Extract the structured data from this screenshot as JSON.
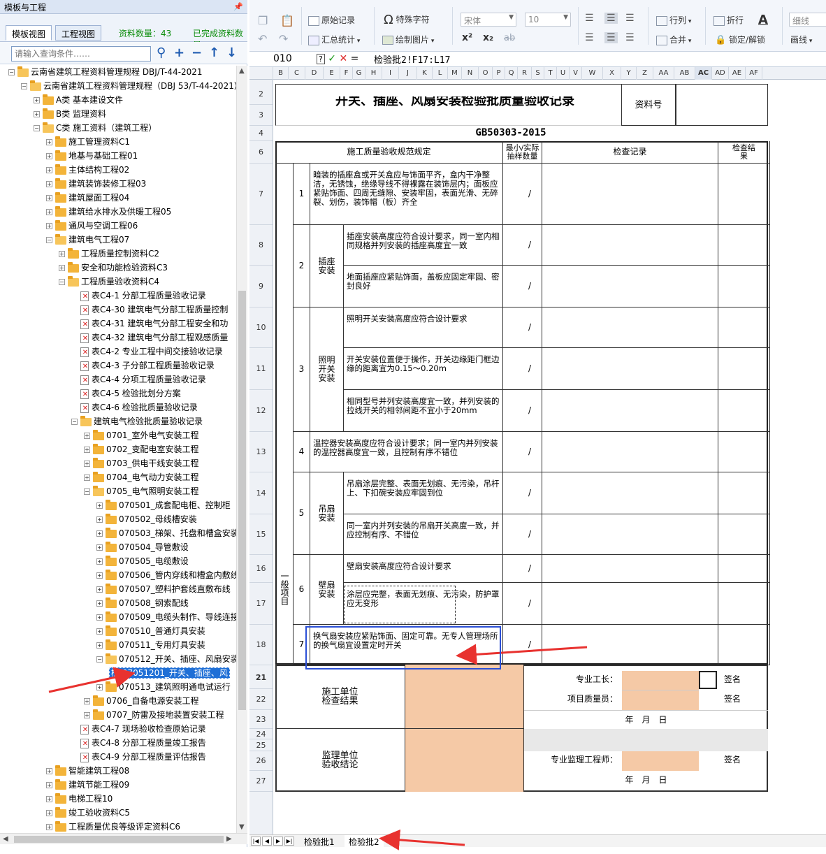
{
  "left_panel": {
    "title": "模板与工程",
    "tabs": [
      "模板视图",
      "工程视图"
    ],
    "count_label": "资料数量：43",
    "complete_label": "已完成资料数量",
    "search_placeholder": "请输入查询条件……",
    "tree": [
      {
        "level": 0,
        "type": "folder",
        "label": "云南省建筑工程资料管理规程 DBJ/T-44-2021",
        "expanded": true
      },
      {
        "level": 1,
        "type": "folder",
        "label": "云南省建筑工程资料管理规程（DBJ 53/T-44-2021）",
        "expanded": true
      },
      {
        "level": 2,
        "type": "folder",
        "label": "A类 基本建设文件",
        "expanded": false
      },
      {
        "level": 2,
        "type": "folder",
        "label": "B类 监理资料",
        "expanded": false
      },
      {
        "level": 2,
        "type": "folder",
        "label": "C类 施工资料（建筑工程）",
        "expanded": true
      },
      {
        "level": 3,
        "type": "folder",
        "label": "施工管理资料C1",
        "expanded": false
      },
      {
        "level": 3,
        "type": "folder",
        "label": "地基与基础工程01",
        "expanded": false
      },
      {
        "level": 3,
        "type": "folder",
        "label": "主体结构工程02",
        "expanded": false
      },
      {
        "level": 3,
        "type": "folder",
        "label": "建筑装饰装修工程03",
        "expanded": false
      },
      {
        "level": 3,
        "type": "folder",
        "label": "建筑屋面工程04",
        "expanded": false
      },
      {
        "level": 3,
        "type": "folder",
        "label": "建筑给水排水及供暖工程05",
        "expanded": false
      },
      {
        "level": 3,
        "type": "folder",
        "label": "通风与空调工程06",
        "expanded": false
      },
      {
        "level": 3,
        "type": "folder",
        "label": "建筑电气工程07",
        "expanded": true
      },
      {
        "level": 4,
        "type": "folder",
        "label": "工程质量控制资料C2",
        "expanded": false
      },
      {
        "level": 4,
        "type": "folder",
        "label": "安全和功能检验资料C3",
        "expanded": false
      },
      {
        "level": 4,
        "type": "folder",
        "label": "工程质量验收资料C4",
        "expanded": true
      },
      {
        "level": 5,
        "type": "doc",
        "label": "表C4-1 分部工程质量验收记录"
      },
      {
        "level": 5,
        "type": "doc",
        "label": "表C4-30 建筑电气分部工程质量控制"
      },
      {
        "level": 5,
        "type": "doc",
        "label": "表C4-31 建筑电气分部工程安全和功"
      },
      {
        "level": 5,
        "type": "doc",
        "label": "表C4-32 建筑电气分部工程观感质量"
      },
      {
        "level": 5,
        "type": "doc",
        "label": "表C4-2 专业工程中间交接验收记录"
      },
      {
        "level": 5,
        "type": "doc",
        "label": "表C4-3 子分部工程质量验收记录"
      },
      {
        "level": 5,
        "type": "doc",
        "label": "表C4-4 分项工程质量验收记录"
      },
      {
        "level": 5,
        "type": "doc",
        "label": "表C4-5 检验批划分方案"
      },
      {
        "level": 5,
        "type": "doc",
        "label": "表C4-6 检验批质量验收记录"
      },
      {
        "level": 5,
        "type": "folder",
        "label": "建筑电气检验批质量验收记录",
        "expanded": true
      },
      {
        "level": 6,
        "type": "folder",
        "label": "0701_室外电气安装工程",
        "expanded": false
      },
      {
        "level": 6,
        "type": "folder",
        "label": "0702_变配电室安装工程",
        "expanded": false
      },
      {
        "level": 6,
        "type": "folder",
        "label": "0703_供电干线安装工程",
        "expanded": false
      },
      {
        "level": 6,
        "type": "folder",
        "label": "0704_电气动力安装工程",
        "expanded": false
      },
      {
        "level": 6,
        "type": "folder",
        "label": "0705_电气照明安装工程",
        "expanded": true
      },
      {
        "level": 7,
        "type": "folder",
        "label": "070501_成套配电柜、控制柜",
        "expanded": false
      },
      {
        "level": 7,
        "type": "folder",
        "label": "070502_母线槽安装",
        "expanded": false
      },
      {
        "level": 7,
        "type": "folder",
        "label": "070503_梯架、托盘和槽盒安装",
        "expanded": false
      },
      {
        "level": 7,
        "type": "folder",
        "label": "070504_导管敷设",
        "expanded": false
      },
      {
        "level": 7,
        "type": "folder",
        "label": "070505_电缆敷设",
        "expanded": false
      },
      {
        "level": 7,
        "type": "folder",
        "label": "070506_管内穿线和槽盒内敷线",
        "expanded": false
      },
      {
        "level": 7,
        "type": "folder",
        "label": "070507_塑料护套线直敷布线",
        "expanded": false
      },
      {
        "level": 7,
        "type": "folder",
        "label": "070508_钢索配线",
        "expanded": false
      },
      {
        "level": 7,
        "type": "folder",
        "label": "070509_电缆头制作、导线连接",
        "expanded": false
      },
      {
        "level": 7,
        "type": "folder",
        "label": "070510_普通灯具安装",
        "expanded": false
      },
      {
        "level": 7,
        "type": "folder",
        "label": "070511_专用灯具安装",
        "expanded": false
      },
      {
        "level": 7,
        "type": "folder",
        "label": "070512_开关、插座、风扇安装",
        "expanded": true
      },
      {
        "level": 8,
        "type": "selected",
        "label": "检 07051201_开关、插座、风"
      },
      {
        "level": 7,
        "type": "folder",
        "label": "070513_建筑照明通电试运行",
        "expanded": false
      },
      {
        "level": 6,
        "type": "folder",
        "label": "0706_自备电源安装工程",
        "expanded": false
      },
      {
        "level": 6,
        "type": "folder",
        "label": "0707_防雷及接地装置安装工程",
        "expanded": false
      },
      {
        "level": 5,
        "type": "doc",
        "label": "表C4-7 现场验收检查原始记录"
      },
      {
        "level": 5,
        "type": "doc",
        "label": "表C4-8 分部工程质量竣工报告"
      },
      {
        "level": 5,
        "type": "doc",
        "label": "表C4-9 分部工程质量评估报告"
      },
      {
        "level": 3,
        "type": "folder",
        "label": "智能建筑工程08",
        "expanded": false
      },
      {
        "level": 3,
        "type": "folder",
        "label": "建筑节能工程09",
        "expanded": false
      },
      {
        "level": 3,
        "type": "folder",
        "label": "电梯工程10",
        "expanded": false
      },
      {
        "level": 3,
        "type": "folder",
        "label": "竣工验收资料C5",
        "expanded": false
      },
      {
        "level": 3,
        "type": "folder",
        "label": "工程质量优良等级评定资料C6",
        "expanded": false
      }
    ]
  },
  "toolbar": {
    "original_record": "原始记录",
    "summary": "汇总统计",
    "special_char": "特殊字符",
    "draw_image": "绘制图片",
    "font_name": "宋体",
    "font_size": "10",
    "superscript": "x²",
    "subscript": "x₂",
    "strike": "ab",
    "row_col": "行列",
    "merge": "合并",
    "wrap": "折行",
    "lock": "锁定/解锁",
    "line_style": "细线",
    "draw_line": "画线"
  },
  "formula_bar": {
    "cell_ref": "010",
    "formula": "检验批2!F17:L17"
  },
  "columns": [
    "B",
    "C",
    "D",
    "E",
    "F",
    "G",
    "H",
    "I",
    "J",
    "K",
    "L",
    "M",
    "N",
    "O",
    "P",
    "Q",
    "R",
    "S",
    "T",
    "U",
    "V",
    "W",
    "X",
    "Y",
    "Z",
    "AA",
    "AB",
    "AC",
    "AD",
    "AE",
    "AF"
  ],
  "rows": [
    "2",
    "3",
    "4",
    "6",
    "7",
    "8",
    "9",
    "10",
    "11",
    "12",
    "13",
    "14",
    "15",
    "16",
    "17",
    "18",
    "21",
    "22",
    "23",
    "24",
    "25",
    "26",
    "27"
  ],
  "form": {
    "title": "开关、插座、风扇安装检验批质量验收记录",
    "standard": "GB50303-2015",
    "record_no_label": "资料号",
    "hdr_spec": "施工质量验收规范规定",
    "hdr_sample": "最小/实际抽样数量",
    "hdr_check": "检查记录",
    "hdr_result": "检查结果",
    "section_label": "一般项目",
    "items": [
      {
        "no": "1",
        "group": "",
        "text": "暗装的插座盒或开关盒应与饰面平齐，盒内干净整洁，无锈蚀，绝缘导线不得裸露在装饰层内；面板应紧贴饰面、四周无缝隙、安装牢固，表面光滑、无碎裂、划伤，装饰帽（板）齐全"
      },
      {
        "no": "2",
        "group": "插座安装",
        "text": "插座安装高度应符合设计要求，同一室内相同规格并列安装的插座高度宜一致"
      },
      {
        "no": "",
        "group": "",
        "text": "地面插座应紧贴饰面，盖板应固定牢固、密封良好"
      },
      {
        "no": "3",
        "group": "照明开关安装",
        "text": "照明开关安装高度应符合设计要求"
      },
      {
        "no": "",
        "group": "",
        "text": "开关安装位置便于操作，开关边缘距门框边缘的距离宜为0.15～0.20m"
      },
      {
        "no": "",
        "group": "",
        "text": "相同型号并列安装高度宜一致，并列安装的拉线开关的相邻间距不宜小于20mm"
      },
      {
        "no": "4",
        "group": "",
        "text": "温控器安装高度应符合设计要求；同一室内并列安装的温控器高度宜一致，且控制有序不错位"
      },
      {
        "no": "5",
        "group": "吊扇安装",
        "text": "吊扇涂层完整、表面无划痕、无污染，吊杆上、下扣碗安装应牢固到位"
      },
      {
        "no": "",
        "group": "",
        "text": "同一室内并列安装的吊扇开关高度一致，并应控制有序、不错位"
      },
      {
        "no": "6",
        "group": "壁扇安装",
        "text": "壁扇安装高度应符合设计要求"
      },
      {
        "no": "",
        "group": "",
        "text": "涂层应完整，表面无划痕、无污染，防护罩应无变形"
      },
      {
        "no": "7",
        "group": "",
        "text": "换气扇安装应紧贴饰面、固定可靠。无专人管理场所的换气扇宜设置定时开关"
      }
    ],
    "slash": "/",
    "constructor_label": "施工单位检查结果",
    "foreman_label": "专业工长：",
    "quality_label": "项目质量员：",
    "sign_label": "签名",
    "date_label": "年　月　日",
    "supervisor_label": "监理单位验收结论",
    "supervisor_engineer_label": "专业监理工程师："
  },
  "sheet_tabs": [
    "检验批1",
    "检验批2"
  ],
  "colors": {
    "peach": "#f5c9a6",
    "accent": "#1f6fd6",
    "arrow": "#e8322f",
    "highlight_box": "#2b4fd6"
  }
}
